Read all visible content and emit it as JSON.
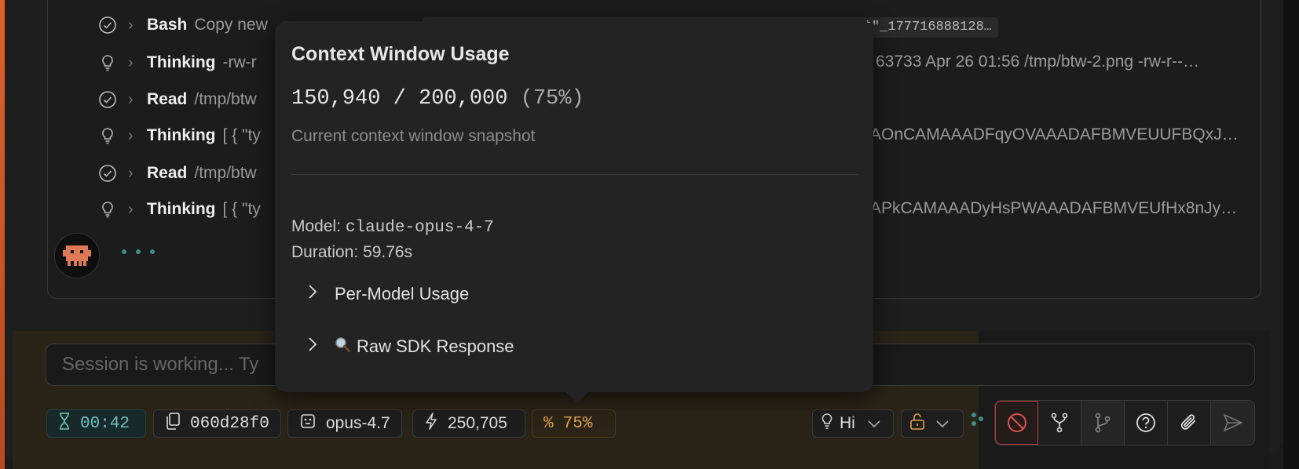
{
  "feed": {
    "rows": [
      {
        "icon": "check-circle-icon",
        "kind": "Bash",
        "detail": "Copy new",
        "right": ""
      },
      {
        "icon": "lightbulb-icon",
        "kind": "Thinking",
        "detail": "-rw-r",
        "right": "63733 Apr 26 01:56 /tmp/btw-2.png -rw-r--…"
      },
      {
        "icon": "check-circle-icon",
        "kind": "Read",
        "detail": "/tmp/btw",
        "right": ""
      },
      {
        "icon": "lightbulb-icon",
        "kind": "Thinking",
        "detail": "[ { \"ty",
        "right": "AOnCAMAAADFqyOVAAADAFBMVEUUFBQxJ…"
      },
      {
        "icon": "check-circle-icon",
        "kind": "Read",
        "detail": "/tmp/btw",
        "right": ""
      },
      {
        "icon": "lightbulb-icon",
        "kind": "Thinking",
        "detail": "[ { \"ty",
        "right": "APkCAMAAADyHsPWAAADAFBMVEUfHx8nJy…"
      }
    ],
    "chip_text": "*\"_177716888128…"
  },
  "popover": {
    "title": "Context Window Usage",
    "usage": "150,940 / 200,000",
    "usage_pct": "(75%)",
    "subtitle": "Current context window snapshot",
    "model_label": "Model:",
    "model_value": "claude-opus-4-7",
    "duration_label": "Duration:",
    "duration_value": "59.76s",
    "per_model": "Per-Model Usage",
    "raw_sdk": "Raw SDK Response"
  },
  "input": {
    "placeholder": "Session is working... Ty"
  },
  "status": {
    "timer": "00:42",
    "session_id": "060d28f0",
    "model": "opus-4.7",
    "tokens": "250,705",
    "percent": "75%",
    "thinking_level": "Hi"
  },
  "colors": {
    "accent_teal": "#6fc1bb",
    "accent_orange": "#e0a04a",
    "stop_red": "#d9534f"
  }
}
